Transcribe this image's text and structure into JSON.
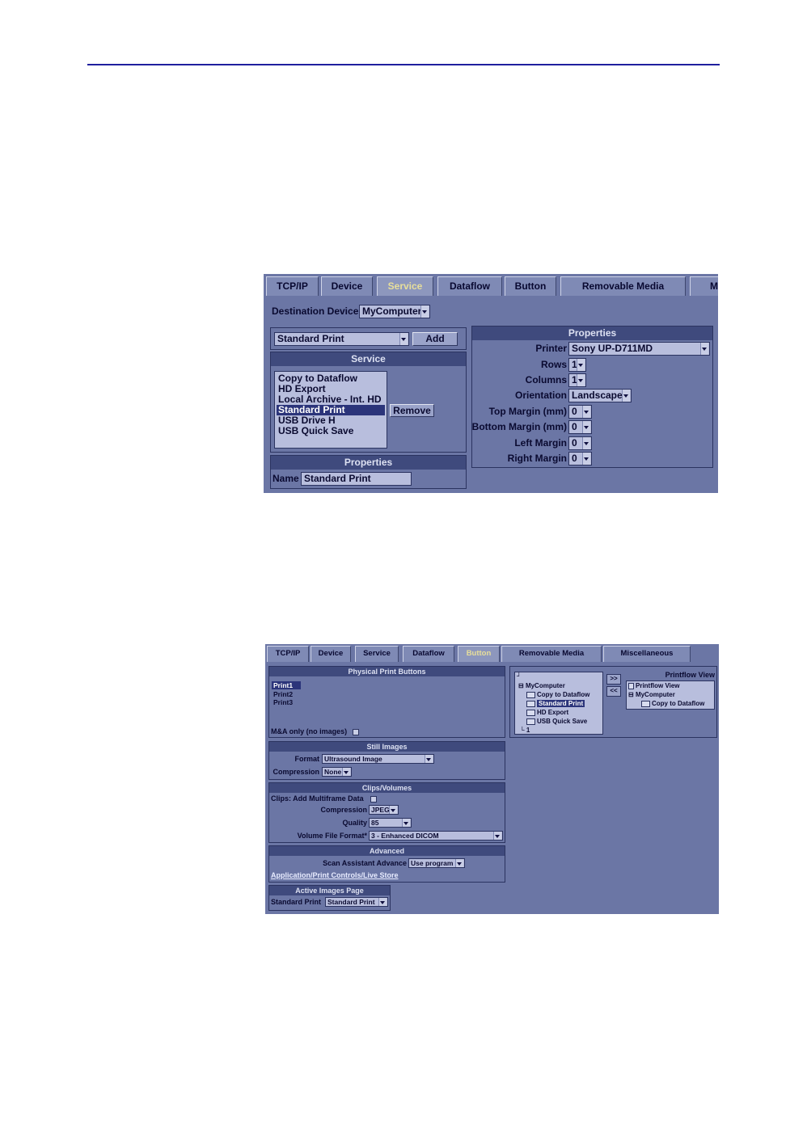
{
  "screen1": {
    "tabs": [
      "TCP/IP",
      "Device",
      "Service",
      "Dataflow",
      "Button",
      "Removable Media",
      "M"
    ],
    "active_tab": "Service",
    "destination_label": "Destination Device",
    "destination_value": "MyComputer",
    "service_select": "Standard Print",
    "add_button": "Add",
    "service_header": "Service",
    "service_list": [
      "Copy to Dataflow",
      "HD Export",
      "Local Archive - Int. HD",
      "Standard Print",
      "USB Drive H",
      "USB Quick Save"
    ],
    "selected_service": "Standard Print",
    "remove_button": "Remove",
    "left_properties_header": "Properties",
    "name_label": "Name",
    "name_value": "Standard Print",
    "right_properties_header": "Properties",
    "properties": [
      {
        "label": "Printer",
        "value": "Sony UP-D711MD"
      },
      {
        "label": "Rows",
        "value": "1"
      },
      {
        "label": "Columns",
        "value": "1"
      },
      {
        "label": "Orientation",
        "value": "Landscape"
      },
      {
        "label": "Top Margin (mm)",
        "value": "0"
      },
      {
        "label": "Bottom Margin (mm)",
        "value": "0"
      },
      {
        "label": "Left Margin",
        "value": "0"
      },
      {
        "label": "Right Margin",
        "value": "0"
      }
    ]
  },
  "screen2": {
    "tabs": [
      "TCP/IP",
      "Device",
      "Service",
      "Dataflow",
      "Button",
      "Removable Media",
      "Miscellaneous"
    ],
    "active_tab": "Button",
    "physical_header": "Physical Print Buttons",
    "print_buttons": [
      "Print1",
      "Print2",
      "Print3"
    ],
    "selected_print": "Print1",
    "ma_only_label": "M&A only (no images)",
    "still_header": "Still Images",
    "format_label": "Format",
    "format_value": "Ultrasound Image",
    "compression_label": "Compression",
    "compression_value": "None",
    "clips_header": "Clips/Volumes",
    "clips_multiframe_label": "Clips: Add Multiframe Data",
    "clips_compression_label": "Compression",
    "clips_compression_value": "JPEG",
    "quality_label": "Quality",
    "quality_value": "85",
    "volume_label": "Volume File Format*",
    "volume_value": "3 - Enhanced DICOM",
    "advanced_header": "Advanced",
    "scan_assistant_label": "Scan Assistant Advance",
    "scan_assistant_value": "Use program",
    "advanced_link": "Application/Print Controls/Live Store",
    "active_images_header": "Active Images Page",
    "active_images_label": "Standard Print",
    "active_images_value": "Standard Print",
    "tree_root": "MyComputer",
    "tree_items": [
      "Copy to Dataflow",
      "Standard Print",
      "HD Export",
      "USB Quick Save"
    ],
    "tree_selected": "Standard Print",
    "tree_bottom": "1",
    "add_arrow": ">>",
    "remove_arrow": "<<",
    "printflow_label": "Printflow View",
    "printflow_tree": [
      "Printflow View",
      "MyComputer",
      "Copy to Dataflow"
    ]
  }
}
